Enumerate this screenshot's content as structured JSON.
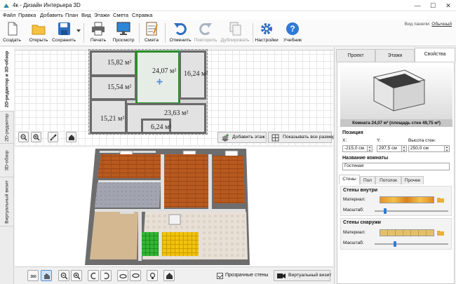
{
  "window": {
    "title": "4к - Дизайн Интерьера 3D",
    "minimize": "—",
    "maximize": "☐",
    "close": "✕"
  },
  "menu": [
    "Файл",
    "Правка",
    "Добавить",
    "План",
    "Вид",
    "Этажи",
    "Смета",
    "Справка"
  ],
  "toolbar": {
    "create": "Создать",
    "open": "Открыть",
    "save": "Сохранить",
    "print": "Печать",
    "preview": "Просмотр",
    "estimate": "Смета",
    "undo": "Отменить",
    "redo": "Повторить",
    "duplicate": "Дублировать",
    "settings": "Настройки",
    "tutorial": "Учебник",
    "panel_view_label": "Вид панели:",
    "panel_view_value": "Обычный"
  },
  "left_tabs": [
    "2D-редактор и 3D-обзор",
    "2D-редактор",
    "3D-обзор",
    "Виртуальный визит"
  ],
  "plan": {
    "rooms": [
      {
        "area": "15,82 м²"
      },
      {
        "area": "24,07 м²"
      },
      {
        "area": "16,24 м²"
      },
      {
        "area": "15,54 м²"
      },
      {
        "area": "15,21 м²"
      },
      {
        "area": "23,63 м²"
      },
      {
        "area": "6,24 м²"
      }
    ],
    "add_floor": "Добавить этаж",
    "show_all": "Показывать все размеры"
  },
  "view3d": {
    "transparent_walls": "Прозрачные стены",
    "virtual_visit": "Виртуальный визит",
    "btn_360": "360"
  },
  "right_panel": {
    "tabs": [
      "Проект",
      "Этажи",
      "Свойства"
    ],
    "caption": "Комната 24,07 м² (площадь стен 49,75 м²)",
    "position_title": "Позиция",
    "x_label": "X:",
    "x_value": "-215,0 см",
    "y_label": "Y:",
    "y_value": "297,5 см",
    "h_label": "Высота стен:",
    "h_value": "250,0 см",
    "room_name_title": "Название комнаты",
    "room_name_value": "Гостиная",
    "sub_tabs": [
      "Стены",
      "Пол",
      "Потолок",
      "Прочее"
    ],
    "walls_inside": "Стены внутри",
    "walls_outside": "Стены снаружи",
    "material": "Материал:",
    "scale": "Масштаб:",
    "scale_inside": 0.14,
    "scale_outside": 0.28
  },
  "colors": {
    "accent": "#2f7ad8",
    "selected_room": "#2a8f2a",
    "wall_plan": "#6a6a6a"
  }
}
